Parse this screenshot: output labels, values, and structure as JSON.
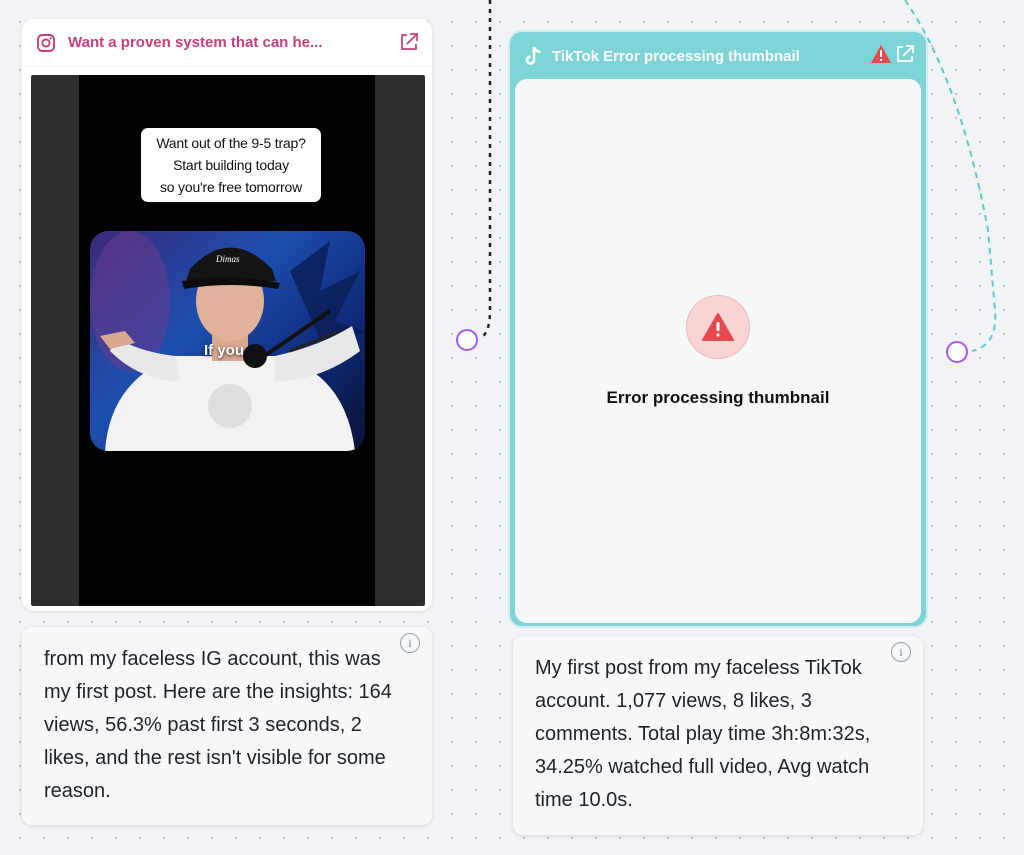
{
  "instagram_card": {
    "title": "Want a proven system that can he...",
    "icon": "instagram-icon",
    "external_link_icon": "external-link-icon",
    "video_caption": [
      "Want out of the 9-5 trap?",
      "Start building today",
      "so you're free tomorrow"
    ],
    "video_overlay_text": "If you",
    "cap_logo_text": "Dimas",
    "brand_color": "#c4407c"
  },
  "tiktok_card": {
    "title": "TikTok Error processing thumbnail",
    "icon": "tiktok-icon",
    "warning_icon": "warning-icon",
    "external_link_icon": "external-link-icon",
    "error_message": "Error processing thumbnail",
    "header_color": "#7ed3d7",
    "error_color": "#e5484d"
  },
  "notes": {
    "left": "from my faceless IG account, this was my first post. Here are the insights: 164 views, 56.3% past first 3 seconds, 2 likes, and the rest isn't visible for some reason.",
    "right": "My first post from my faceless TikTok account. 1,077 views, 8 likes, 3 comments. Total play time 3h:8m:32s, 34.25% watched full video, Avg watch time 10.0s.",
    "info_glyph": "i"
  },
  "connectors": {
    "handle_color": "#a25cf0",
    "edge_dark_color": "#1f1f1f",
    "edge_teal_color": "#5ec7cf"
  }
}
